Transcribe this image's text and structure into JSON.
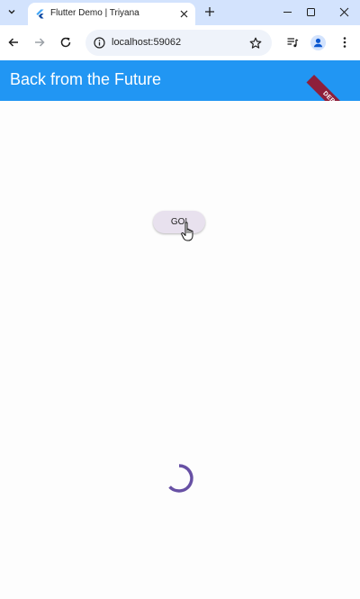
{
  "browser": {
    "tab": {
      "title": "Flutter Demo | Triyana"
    },
    "address_bar": {
      "url": "localhost:59062"
    },
    "icons": {
      "tab_search": "chevron-down-icon",
      "favicon": "flutter-logo-icon",
      "tab_close": "close-icon",
      "new_tab": "plus-icon",
      "minimize": "minimize-icon",
      "maximize": "maximize-icon",
      "close_window": "close-icon",
      "back": "arrow-left-icon",
      "forward": "arrow-right-icon",
      "reload": "reload-icon",
      "site_info": "info-icon",
      "bookmark": "star-icon",
      "media": "media-queue-icon",
      "profile": "profile-icon",
      "menu": "kebab-menu-icon"
    }
  },
  "app": {
    "appbar": {
      "title": "Back from the Future",
      "color": "#2196f3"
    },
    "debug_banner": {
      "text": "DEBUG",
      "color": "#8e1f3b"
    },
    "go_button": {
      "label": "GO!"
    },
    "spinner": {
      "color": "#6750a4",
      "icon": "loading-spinner-icon"
    }
  }
}
